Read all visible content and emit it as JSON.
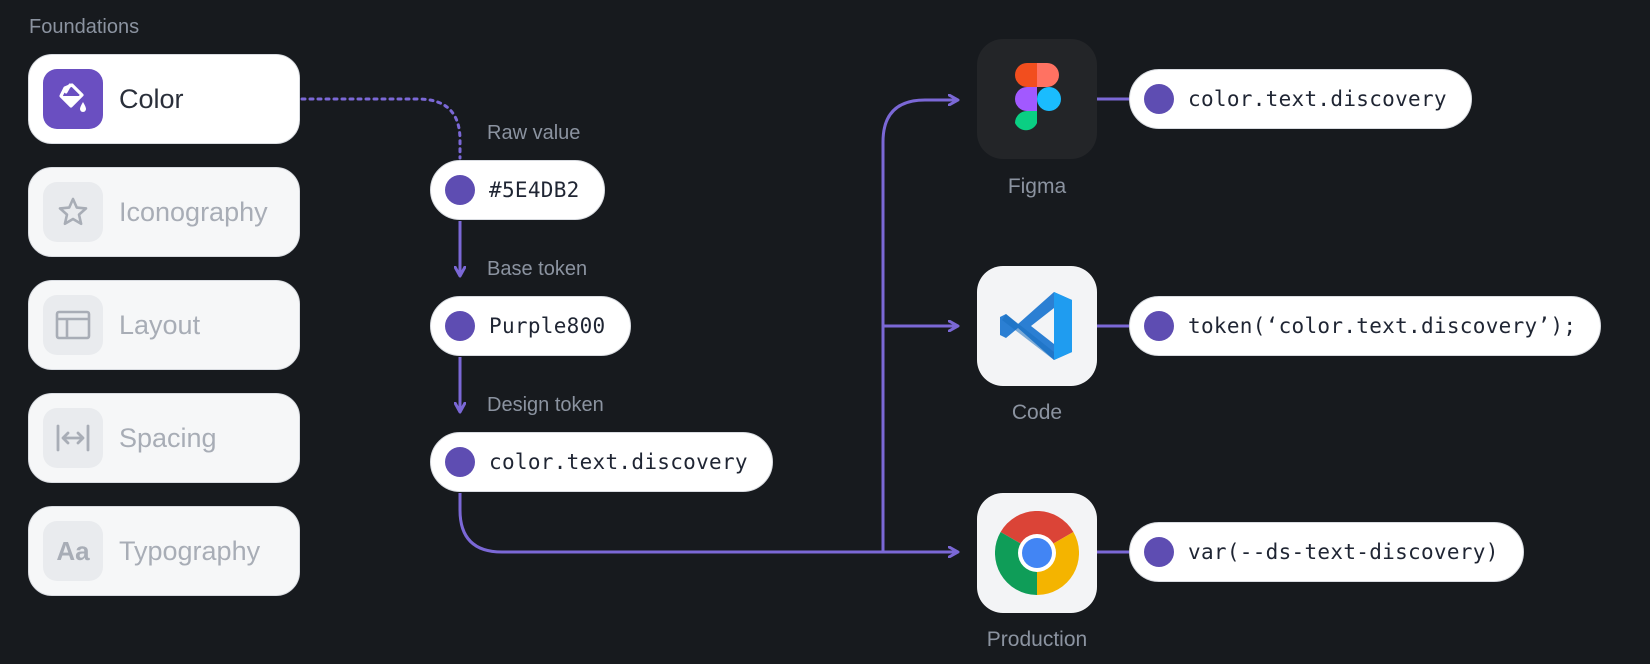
{
  "section_title": "Foundations",
  "categories": [
    {
      "label": "Color",
      "icon": "paint-bucket-icon",
      "active": true
    },
    {
      "label": "Iconography",
      "icon": "star-icon",
      "active": false
    },
    {
      "label": "Layout",
      "icon": "layout-icon",
      "active": false
    },
    {
      "label": "Spacing",
      "icon": "spacing-icon",
      "active": false
    },
    {
      "label": "Typography",
      "icon": "typography-icon",
      "active": false
    }
  ],
  "typography_icon_text": "Aa",
  "steps": [
    {
      "label": "Raw value",
      "value": "#5E4DB2"
    },
    {
      "label": "Base token",
      "value": "Purple800"
    },
    {
      "label": "Design token",
      "value": "color.text.discovery"
    }
  ],
  "targets": [
    {
      "label": "Figma",
      "icon": "figma-icon",
      "value": "color.text.discovery"
    },
    {
      "label": "Code",
      "icon": "vscode-icon",
      "value": "token(‘color.text.discovery’);"
    },
    {
      "label": "Production",
      "icon": "chrome-icon",
      "value": "var(--ds-text-discovery)"
    }
  ],
  "colors": {
    "accent": "#5e4db2",
    "line": "#7b68d6",
    "background": "#171a1e"
  }
}
